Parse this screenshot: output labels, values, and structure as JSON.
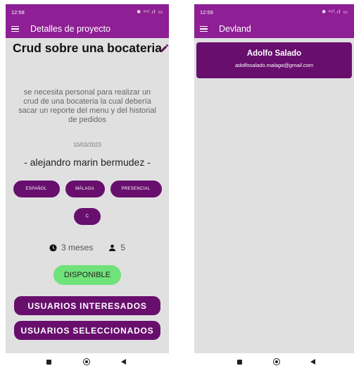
{
  "left": {
    "status": {
      "time": "12:58",
      "icons": "✱ ᵛᵒˡ.ıl ▭"
    },
    "appbar": {
      "title": "Detalles de proyecto"
    },
    "project": {
      "title": "Crud sobre una bocateria",
      "description": "se necesita personal para realizar un crud de una bocateria la cual debería sacar un reporte del menu y del historial de pedidos",
      "date": "10/03/2023",
      "owner": "- alejandro marin bermudez -",
      "tags": [
        "ESPAÑOL",
        "MÁLAGA",
        "PRESENCIAL",
        "C"
      ],
      "duration": "3 meses",
      "people": "5",
      "status": "DISPONIBLE"
    },
    "buttons": {
      "interested": "USUARIOS INTERESADOS",
      "selected": "USUARIOS SELECCIONADOS"
    }
  },
  "right": {
    "status": {
      "time": "12:59",
      "icons": "✱ ᵛᵒˡ.ıl ▭"
    },
    "appbar": {
      "title": "Devland"
    },
    "user": {
      "name": "Adolfo Salado",
      "email": "adolfosalado.malaga@gmail.com"
    }
  },
  "colors": {
    "appbar": "#8e1f95",
    "primary": "#680f6e",
    "available": "#6fe27a",
    "background": "#e0e0e0"
  }
}
